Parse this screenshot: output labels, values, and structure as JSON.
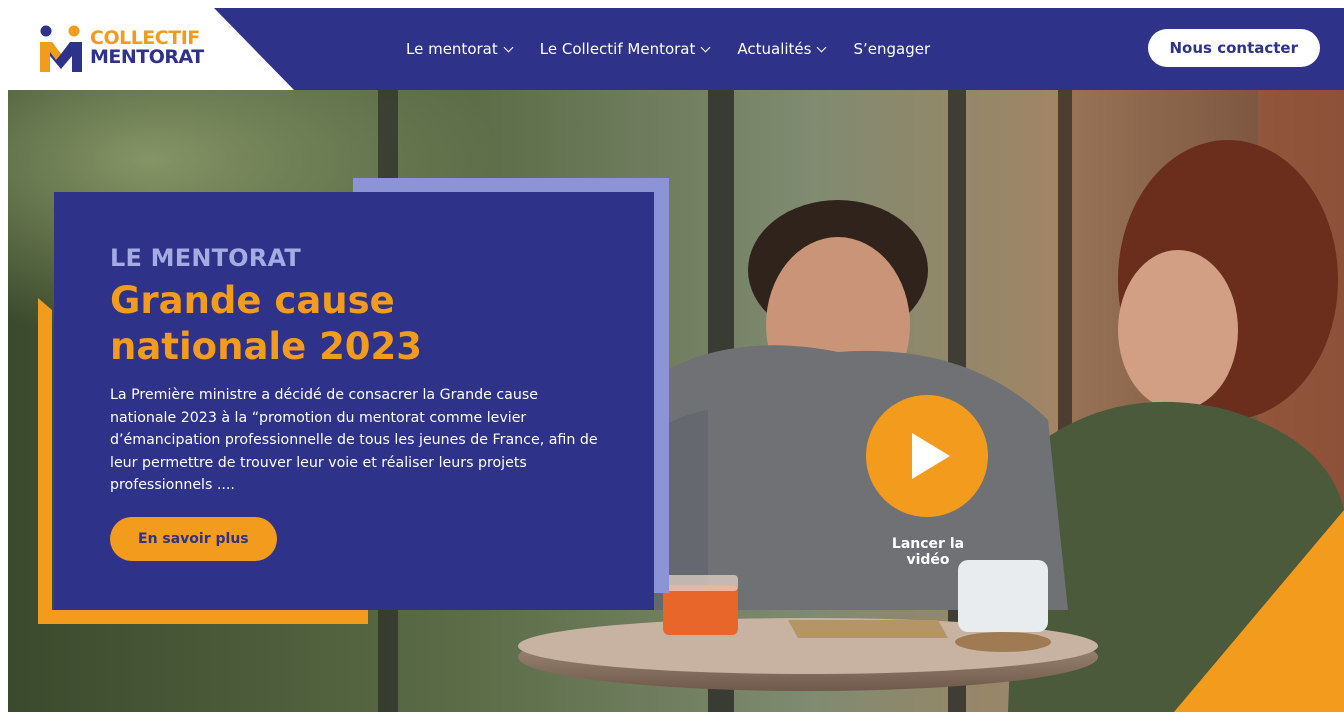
{
  "brand": {
    "name_line1": "COLLECTIF",
    "name_line2": "MENTORAT",
    "colors": {
      "navy": "#2e3288",
      "orange": "#f39b1d",
      "lavender": "#8d94d6"
    }
  },
  "nav": {
    "items": [
      {
        "label": "Le mentorat",
        "has_dropdown": true
      },
      {
        "label": "Le Collectif Mentorat",
        "has_dropdown": true
      },
      {
        "label": "Actualités",
        "has_dropdown": true
      },
      {
        "label": "S’engager",
        "has_dropdown": false
      }
    ],
    "contact_label": "Nous contacter"
  },
  "hero": {
    "kicker": "LE MENTORAT",
    "title_line1": "Grande cause",
    "title_line2": "nationale 2023",
    "description": "La Première ministre a décidé de consacrer la Grande cause nationale 2023 à la “promotion du mentorat comme levier d’émancipation professionnelle de tous les jeunes de France, afin de leur permettre de trouver leur voie et réaliser leurs projets professionnels ....",
    "cta_label": "En savoir plus",
    "video_label": "Lancer la vidéo",
    "play_icon": "play-icon"
  }
}
